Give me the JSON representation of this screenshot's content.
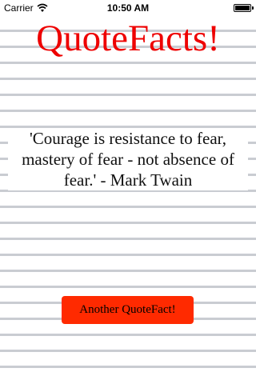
{
  "status_bar": {
    "carrier": "Carrier",
    "time": "10:50 AM",
    "wifi_icon": "wifi-icon",
    "battery_icon": "battery-icon",
    "battery_level": 0.95
  },
  "app": {
    "title": "QuoteFacts!",
    "title_color": "#ee0000"
  },
  "quote": {
    "text": "'Courage is resistance to fear, mastery of fear - not absence of fear.' - Mark Twain"
  },
  "button": {
    "label": "Another QuoteFact!",
    "background_color": "#ff2a00"
  }
}
